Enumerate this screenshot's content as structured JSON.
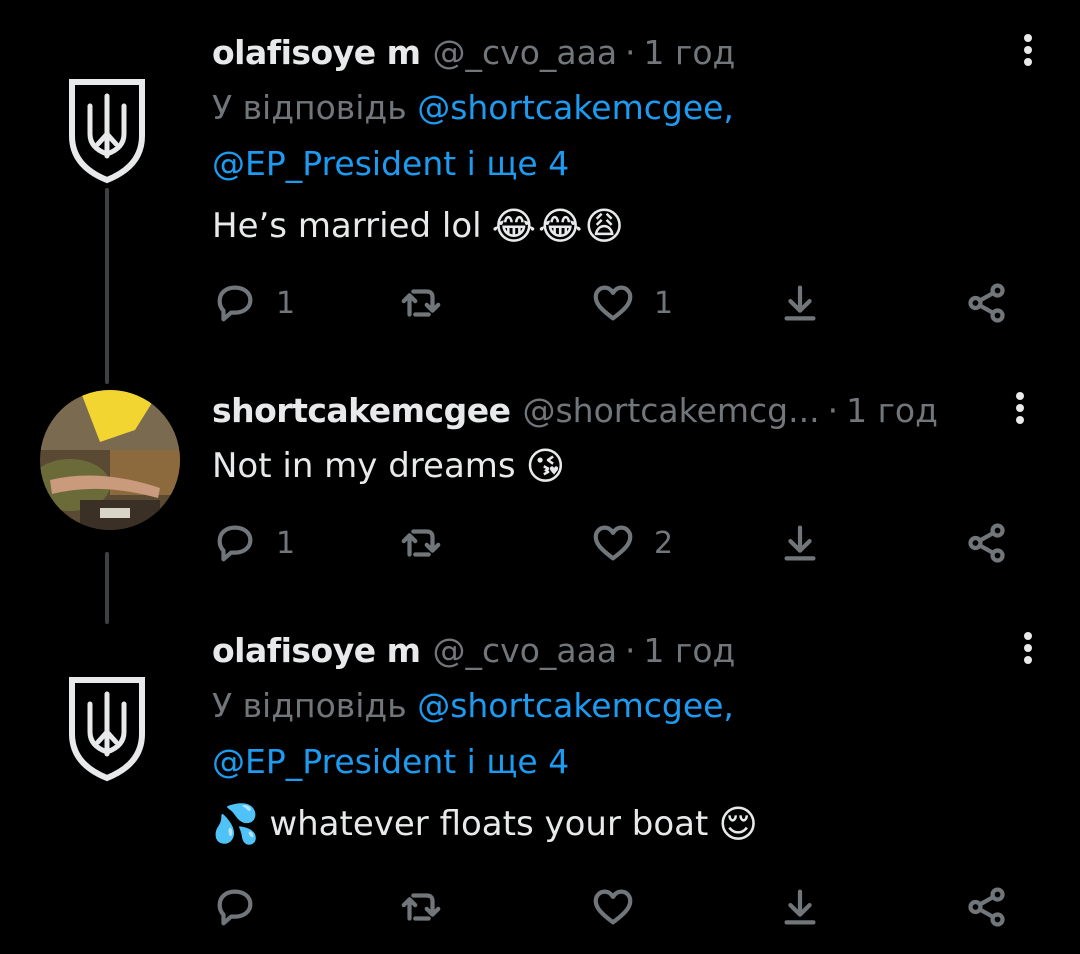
{
  "tweets": [
    {
      "name": "olafisoye m",
      "handle": "@_cvo_aaa",
      "separator": "·",
      "time": "1 год",
      "replying_prefix": "У відповідь",
      "replying_link1": "@shortcakemcgee,",
      "replying_link2": "@EP_President і ще 4",
      "text": "He’s married lol",
      "emojis": [
        "😂",
        "😂",
        "😩"
      ],
      "reply_count": "1",
      "retweet_count": "",
      "like_count": "1"
    },
    {
      "name": "shortcakemcgee",
      "handle": "@shortcakemcg...",
      "separator": "·",
      "time": "1 год",
      "text": "Not in my dreams",
      "emojis": [
        "😘"
      ],
      "reply_count": "1",
      "retweet_count": "",
      "like_count": "2"
    },
    {
      "name": "olafisoye m",
      "handle": "@_cvo_aaa",
      "separator": "·",
      "time": "1 год",
      "replying_prefix": "У відповідь",
      "replying_link1": "@shortcakemcgee,",
      "replying_link2": "@EP_President і ще 4",
      "leading_emoji": "💦",
      "text": "whatever floats your boat",
      "emojis": [
        "😌"
      ],
      "reply_count": "",
      "retweet_count": "",
      "like_count": ""
    }
  ],
  "icons": {
    "reply": "reply-icon",
    "retweet": "retweet-icon",
    "like": "heart-icon",
    "download": "download-icon",
    "share": "share-icon",
    "more": "more-icon"
  },
  "colors": {
    "background": "#000000",
    "text": "#e7e9ea",
    "secondary": "#71767b",
    "link": "#1d9bf0"
  }
}
